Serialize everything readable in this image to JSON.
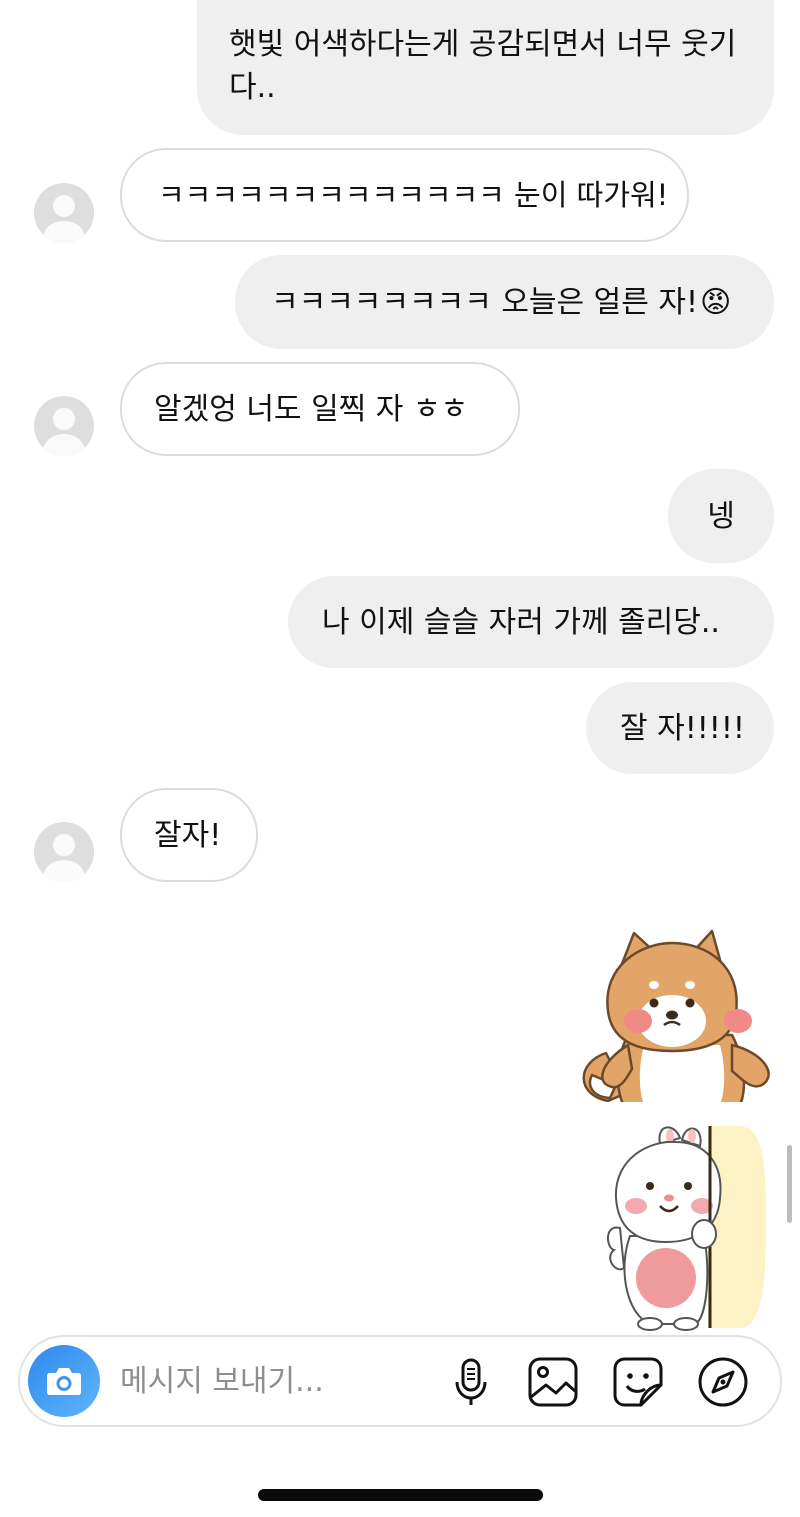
{
  "messages": [
    {
      "side": "sent",
      "text": "햇빛 어색하다는게 공감되면서 너무 웃기다.."
    },
    {
      "side": "received",
      "text": "ㅋㅋㅋㅋㅋㅋㅋㅋㅋㅋㅋㅋㅋ 눈이 따가워!"
    },
    {
      "side": "sent",
      "text": "ㅋㅋㅋㅋㅋㅋㅋㅋ 오늘은 얼른 자!"
    },
    {
      "side": "received",
      "text": "알겠엉 너도 일찍 자 ㅎㅎ"
    },
    {
      "side": "sent",
      "text": "넹"
    },
    {
      "side": "sent",
      "text": "나 이제 슬슬 자러 가께 졸리당.."
    },
    {
      "side": "sent",
      "text": "잘 자!!!!!"
    },
    {
      "side": "received",
      "text": "잘자!"
    }
  ],
  "emoji": {
    "angry_face": "😡"
  },
  "stickers": [
    {
      "name": "shiba-dog-sticker",
      "icon": "shiba-dog-hands-on-hips"
    },
    {
      "name": "bunny-peek-sticker",
      "icon": "white-bunny-peeking-from-wall"
    }
  ],
  "composer": {
    "placeholder": "메시지 보내기...",
    "icons": [
      "camera-icon",
      "microphone-icon",
      "gallery-icon",
      "sticker-icon",
      "compass-icon"
    ]
  },
  "colors": {
    "sent_bubble": "#efefef",
    "received_border": "#dcdcdc",
    "camera_button": "#3797f0",
    "avatar_placeholder": "#dedede"
  }
}
